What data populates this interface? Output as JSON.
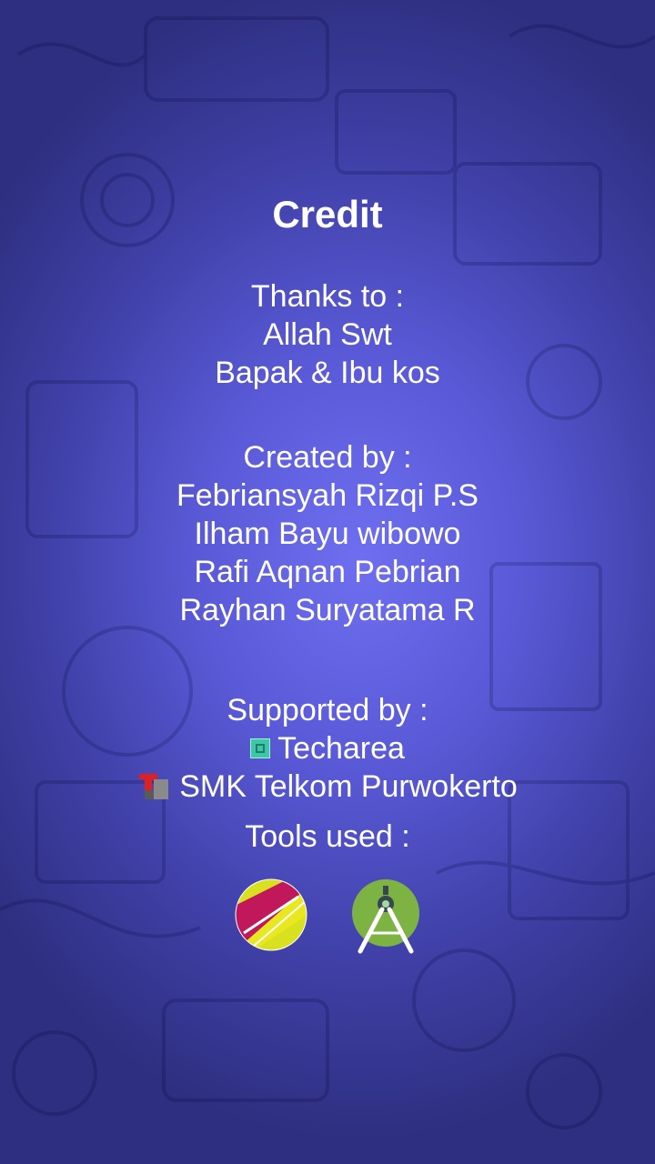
{
  "title": "Credit",
  "thanks": {
    "heading": "Thanks to :",
    "names": [
      "Allah Swt",
      "Bapak & Ibu kos"
    ]
  },
  "created": {
    "heading": "Created by :",
    "names": [
      "Febriansyah Rizqi P.S",
      "Ilham Bayu wibowo",
      "Rafi Aqnan Pebrian",
      "Rayhan Suryatama R"
    ]
  },
  "supported": {
    "heading": "Supported by :",
    "items": [
      {
        "label": "Techarea",
        "icon": "techarea-logo-icon"
      },
      {
        "label": "SMK Telkom Purwokerto",
        "icon": "telkom-school-logo-icon"
      }
    ]
  },
  "tools": {
    "heading": "Tools used :",
    "items": [
      {
        "icon": "gravit-designer-icon"
      },
      {
        "icon": "android-studio-icon"
      }
    ]
  },
  "colors": {
    "background_center": "#6e6ff0",
    "background_edge": "#2e2f80",
    "text": "#ffffff"
  }
}
